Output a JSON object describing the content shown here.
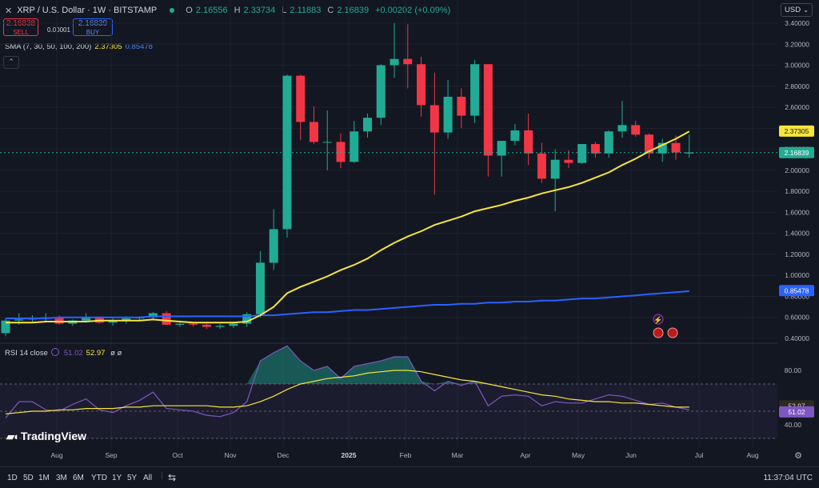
{
  "header": {
    "symbol_text": "XRP / U.S. Dollar · 1W · BITSTAMP",
    "ohlc": [
      {
        "label": "O",
        "value": "2.16556"
      },
      {
        "label": "H",
        "value": "2.33734"
      },
      {
        "label": "L",
        "value": "2.11883"
      },
      {
        "label": "C",
        "value": "2.16839"
      }
    ],
    "change": "+0.00202 (+0.09%)"
  },
  "trade": {
    "sell_price": "2.16838",
    "sell_label": "SELL",
    "spread": "0.00001",
    "buy_price": "2.16839",
    "buy_label": "BUY"
  },
  "sma_legend": {
    "text": "SMA (7, 30, 50, 100, 200)",
    "v1": "2.37305",
    "v2": "0.85478"
  },
  "rsi_legend": {
    "text": "RSI 14 close",
    "v1": "51.02",
    "v2": "52.97",
    "sym": "ø ø"
  },
  "currency": "USD",
  "colors": {
    "bg": "#131722",
    "up": "#22ab94",
    "down": "#f23645",
    "sma_yellow": "#f7e53b",
    "sma_blue": "#2962ff",
    "rsi": "#7e57c2",
    "rsi_ma": "#f7e53b"
  },
  "bottom": {
    "ranges": [
      "1D",
      "5D",
      "1M",
      "3M",
      "6M",
      "YTD",
      "1Y",
      "5Y",
      "All"
    ],
    "time": "11:37:04 UTC"
  },
  "logo_text": "TradingView",
  "chart_data": {
    "type": "candlestick",
    "title": "XRP / U.S. Dollar · 1W · BITSTAMP",
    "ylim": [
      0.38,
      3.45
    ],
    "y_ticks": [
      "3.40000",
      "3.20000",
      "3.00000",
      "2.80000",
      "2.60000",
      "2.40000",
      "2.20000",
      "2.00000",
      "1.80000",
      "1.60000",
      "1.40000",
      "1.20000",
      "1.00000",
      "0.80000",
      "0.60000",
      "0.40000"
    ],
    "x_ticks": [
      "Aug",
      "Sep",
      "Oct",
      "Nov",
      "Dec",
      "2025",
      "Feb",
      "Mar",
      "Apr",
      "May",
      "Jun",
      "Jul",
      "Aug"
    ],
    "candles": [
      [
        0.45,
        0.59,
        0.42,
        0.57
      ],
      [
        0.57,
        0.64,
        0.53,
        0.58
      ],
      [
        0.58,
        0.62,
        0.55,
        0.59
      ],
      [
        0.59,
        0.64,
        0.55,
        0.6
      ],
      [
        0.6,
        0.62,
        0.53,
        0.54
      ],
      [
        0.54,
        0.58,
        0.52,
        0.57
      ],
      [
        0.57,
        0.64,
        0.55,
        0.6
      ],
      [
        0.6,
        0.61,
        0.54,
        0.55
      ],
      [
        0.55,
        0.6,
        0.52,
        0.57
      ],
      [
        0.57,
        0.61,
        0.54,
        0.59
      ],
      [
        0.59,
        0.61,
        0.57,
        0.6
      ],
      [
        0.6,
        0.65,
        0.58,
        0.64
      ],
      [
        0.64,
        0.66,
        0.55,
        0.53
      ],
      [
        0.53,
        0.55,
        0.51,
        0.54
      ],
      [
        0.54,
        0.55,
        0.51,
        0.53
      ],
      [
        0.53,
        0.54,
        0.49,
        0.51
      ],
      [
        0.51,
        0.54,
        0.49,
        0.52
      ],
      [
        0.52,
        0.56,
        0.5,
        0.54
      ],
      [
        0.54,
        0.65,
        0.51,
        0.63
      ],
      [
        0.63,
        1.23,
        0.6,
        1.12
      ],
      [
        1.12,
        1.63,
        1.05,
        1.44
      ],
      [
        1.44,
        2.91,
        1.36,
        2.9
      ],
      [
        2.9,
        2.91,
        2.29,
        2.46
      ],
      [
        2.46,
        2.61,
        2.25,
        2.27
      ],
      [
        2.27,
        2.57,
        2.0,
        2.27
      ],
      [
        2.27,
        2.35,
        2.02,
        2.08
      ],
      [
        2.08,
        2.47,
        2.07,
        2.37
      ],
      [
        2.37,
        2.54,
        2.31,
        2.5
      ],
      [
        2.5,
        3.01,
        2.43,
        3.0
      ],
      [
        3.0,
        3.4,
        2.88,
        3.06
      ],
      [
        3.06,
        3.39,
        2.78,
        3.01
      ],
      [
        3.01,
        3.08,
        2.51,
        2.62
      ],
      [
        2.62,
        2.93,
        1.77,
        2.36
      ],
      [
        2.36,
        2.86,
        2.3,
        2.7
      ],
      [
        2.7,
        2.78,
        2.4,
        2.52
      ],
      [
        2.52,
        3.05,
        2.45,
        3.01
      ],
      [
        3.01,
        3.01,
        1.94,
        2.14
      ],
      [
        2.14,
        2.28,
        1.94,
        2.28
      ],
      [
        2.28,
        2.44,
        2.24,
        2.38
      ],
      [
        2.38,
        2.54,
        2.05,
        2.16
      ],
      [
        2.16,
        2.26,
        1.88,
        1.92
      ],
      [
        1.92,
        2.2,
        1.61,
        2.1
      ],
      [
        2.1,
        2.19,
        2.02,
        2.07
      ],
      [
        2.07,
        2.23,
        2.06,
        2.25
      ],
      [
        2.25,
        2.27,
        2.12,
        2.16
      ],
      [
        2.16,
        2.38,
        2.12,
        2.37
      ],
      [
        2.37,
        2.66,
        2.31,
        2.43
      ],
      [
        2.43,
        2.47,
        2.32,
        2.34
      ],
      [
        2.34,
        2.35,
        2.11,
        2.16
      ],
      [
        2.16,
        2.3,
        2.08,
        2.26
      ],
      [
        2.26,
        2.33,
        2.1,
        2.17
      ],
      [
        2.16,
        2.34,
        2.12,
        2.17
      ]
    ],
    "series": [
      {
        "name": "SMA 7",
        "color": "#f7e53b",
        "values": [
          0.55,
          0.55,
          0.55,
          0.56,
          0.56,
          0.56,
          0.56,
          0.57,
          0.57,
          0.57,
          0.57,
          0.58,
          0.57,
          0.56,
          0.55,
          0.55,
          0.55,
          0.55,
          0.56,
          0.62,
          0.7,
          0.83,
          0.89,
          0.94,
          0.99,
          1.05,
          1.1,
          1.16,
          1.24,
          1.31,
          1.37,
          1.42,
          1.48,
          1.52,
          1.56,
          1.61,
          1.64,
          1.67,
          1.71,
          1.74,
          1.78,
          1.81,
          1.84,
          1.88,
          1.93,
          1.98,
          2.05,
          2.11,
          2.18,
          2.24,
          2.3,
          2.37
        ]
      },
      {
        "name": "SMA 200",
        "color": "#2962ff",
        "values": [
          0.59,
          0.59,
          0.59,
          0.59,
          0.6,
          0.6,
          0.6,
          0.6,
          0.6,
          0.6,
          0.6,
          0.61,
          0.61,
          0.61,
          0.61,
          0.61,
          0.61,
          0.61,
          0.61,
          0.62,
          0.62,
          0.63,
          0.64,
          0.65,
          0.65,
          0.66,
          0.67,
          0.67,
          0.68,
          0.69,
          0.7,
          0.71,
          0.72,
          0.72,
          0.73,
          0.73,
          0.74,
          0.74,
          0.75,
          0.75,
          0.76,
          0.76,
          0.77,
          0.78,
          0.78,
          0.79,
          0.8,
          0.81,
          0.82,
          0.83,
          0.84,
          0.85
        ]
      },
      {
        "name": "RSI 14",
        "color": "#7e57c2",
        "values": [
          45,
          57,
          57,
          51,
          50,
          55,
          59,
          51,
          49,
          54,
          58,
          64,
          52,
          51,
          50,
          47,
          46,
          49,
          57,
          87,
          93,
          98,
          87,
          80,
          83,
          74,
          83,
          85,
          87,
          90,
          90,
          72,
          65,
          72,
          69,
          72,
          54,
          61,
          62,
          61,
          54,
          57,
          56,
          56,
          59,
          62,
          61,
          58,
          55,
          56,
          53,
          51
        ]
      },
      {
        "name": "RSI MA",
        "color": "#f7e53b",
        "values": [
          48,
          49,
          50,
          50,
          51,
          51,
          52,
          52,
          52,
          53,
          53,
          54,
          54,
          54,
          54,
          54,
          53,
          53,
          54,
          57,
          61,
          66,
          70,
          72,
          74,
          75,
          76,
          78,
          79,
          80,
          80,
          79,
          77,
          75,
          73,
          72,
          70,
          68,
          66,
          64,
          62,
          61,
          59,
          58,
          57,
          57,
          56,
          56,
          55,
          54,
          53,
          53
        ]
      }
    ],
    "rsi_ticks": [
      "80.00",
      "40.00"
    ],
    "last_labels": {
      "sma7": "2.37305",
      "close": "2.16839",
      "sma200": "0.85478",
      "rsi_ma": "52.97",
      "rsi": "51.02"
    }
  }
}
